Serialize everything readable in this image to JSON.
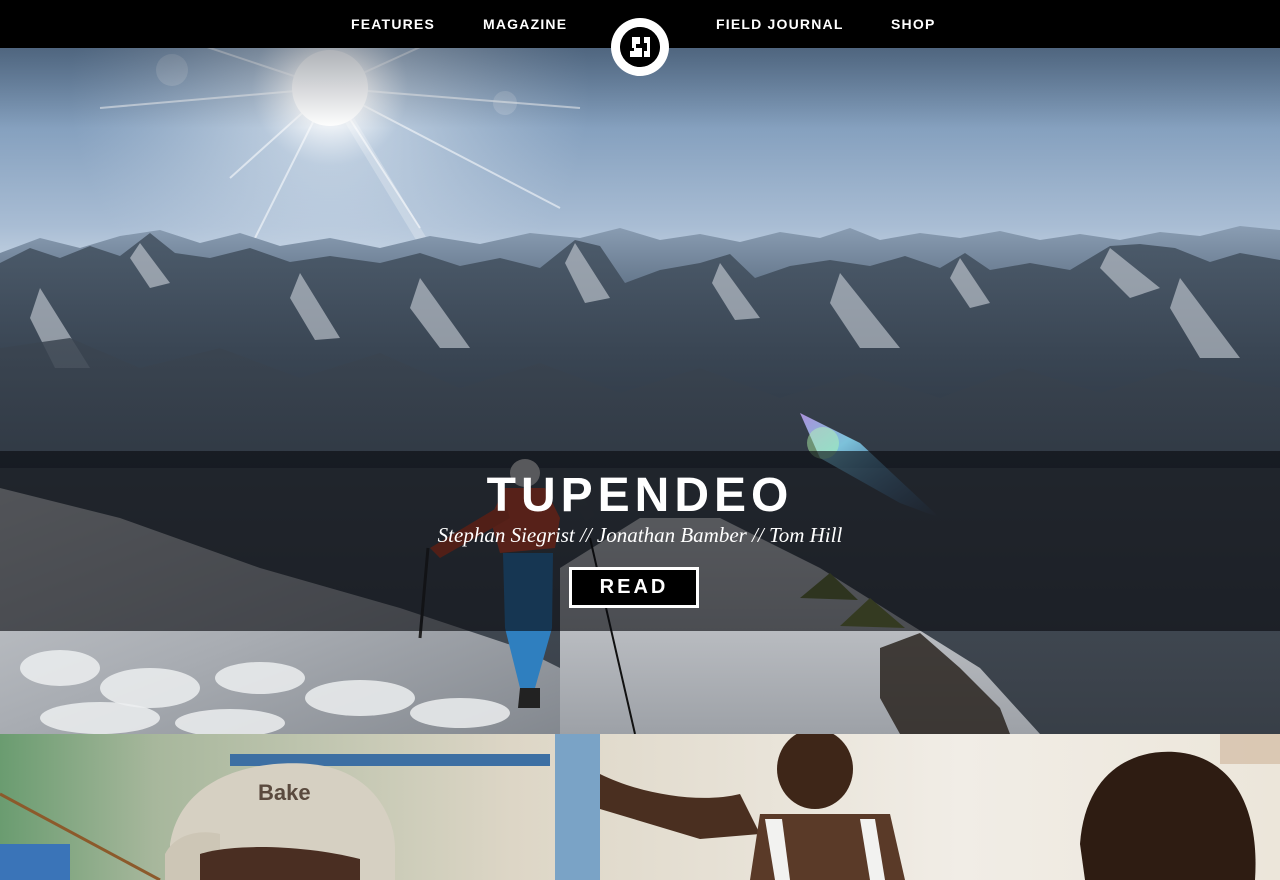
{
  "nav": {
    "features": "FEATURES",
    "magazine": "MAGAZINE",
    "field_journal": "FIELD JOURNAL",
    "shop": "SHOP",
    "logo_icon": "brand-logo-icon"
  },
  "hero": {
    "title": "TUPENDEO",
    "authors": "Stephan Siegrist // Jonathan Bamber // Tom Hill",
    "read_label": "READ"
  },
  "second_section": {
    "cap_text": "Bake"
  },
  "colors": {
    "nav_bg": "#000000",
    "text": "#ffffff",
    "button_bg": "#000000"
  }
}
